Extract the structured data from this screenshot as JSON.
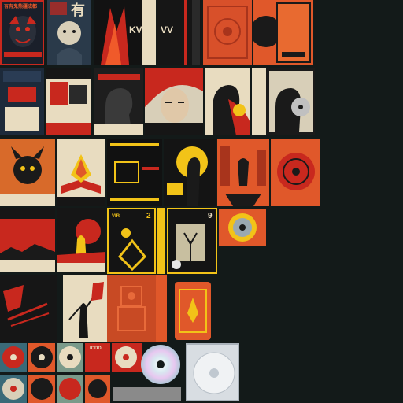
{
  "sheet": {
    "background": "#131a19",
    "rows": [
      {
        "row": 1,
        "tiles": [
          "cover-demon-mask",
          "cover-monk-portrait",
          "cover-kv-brushstroke",
          "cover-vv-dark",
          "cover-orange-ornate",
          "cover-orange-vinyl"
        ]
      },
      {
        "row": 2,
        "tiles": [
          "cover-blue-grid",
          "cover-red-collage",
          "cover-profile-dark",
          "cover-face-red-hair",
          "cover-silhouette-red",
          "cover-silhouette-disc"
        ]
      },
      {
        "row": 3,
        "tiles": [
          "cover-demon-orange",
          "cover-open-book",
          "cover-black-yellow",
          "cover-yellow-moon",
          "cover-red-figure",
          "cover-red-record"
        ]
      },
      {
        "row": 4,
        "tiles": [
          "cover-red-sunset",
          "cover-warrior-black",
          "cover-yellow-geometric",
          "cover-yellow-geometric-2",
          "cover-tree-figure",
          "cover-orange-disc"
        ]
      },
      {
        "row": 5,
        "tiles": [
          "cover-red-calligraphy",
          "cover-warrior-calligraphy",
          "cover-robot-orange",
          "cover-orange-strip",
          "cover-orange-gold-label"
        ]
      },
      {
        "row": 6,
        "tiles": [
          "vinyl-set-small",
          "cd-red-pair",
          "cd-silver",
          "cd-jewel-case"
        ]
      }
    ]
  },
  "texts": {
    "t1": "有有鬼熊疆成都",
    "t2": "有",
    "t3": "KV",
    "t4": "VV",
    "t5": "VIR",
    "t6": "2",
    "t7": "9",
    "t8": "ICDD"
  },
  "colors": {
    "orange": "#e0582a",
    "red": "#c8281e",
    "yellow": "#f2c318",
    "cream": "#e8dcc0",
    "black": "#101010",
    "navy": "#1d2a3a"
  }
}
